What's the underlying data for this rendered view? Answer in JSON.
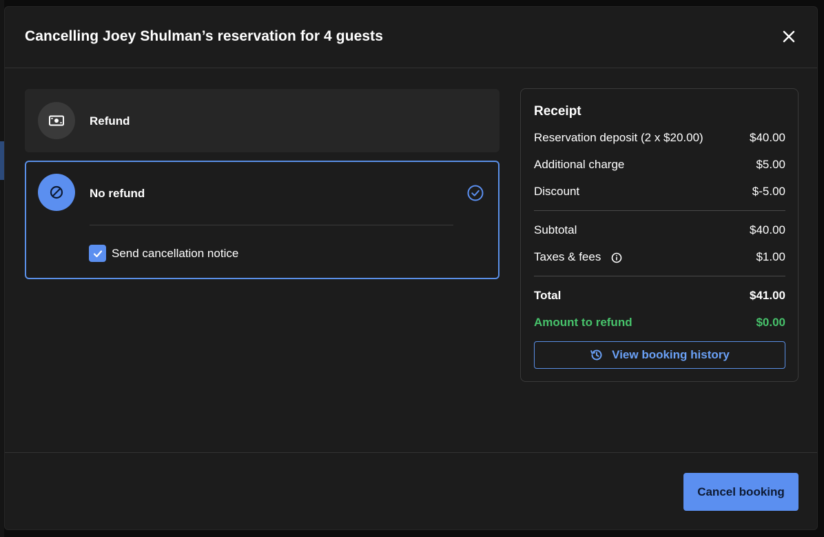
{
  "modal": {
    "title": "Cancelling Joey Shulman’s reservation for 4 guests"
  },
  "options": {
    "refund_label": "Refund",
    "no_refund_label": "No refund",
    "selected": "no_refund",
    "send_notice_label": "Send cancellation notice",
    "send_notice_checked": true
  },
  "receipt": {
    "title": "Receipt",
    "rows": [
      {
        "label": "Reservation deposit (2 x $20.00)",
        "amount": "$40.00"
      },
      {
        "label": "Additional charge",
        "amount": "$5.00"
      },
      {
        "label": "Discount",
        "amount": "$-5.00"
      }
    ],
    "subtotal_label": "Subtotal",
    "subtotal_amount": "$40.00",
    "taxes_label": "Taxes & fees",
    "taxes_amount": "$1.00",
    "total_label": "Total",
    "total_amount": "$41.00",
    "refund_label": "Amount to refund",
    "refund_amount": "$0.00",
    "history_button": "View booking history"
  },
  "footer": {
    "cancel_button": "Cancel booking"
  },
  "colors": {
    "accent": "#5b8ff0",
    "success": "#47c26b",
    "surface": "#1c1c1c"
  }
}
